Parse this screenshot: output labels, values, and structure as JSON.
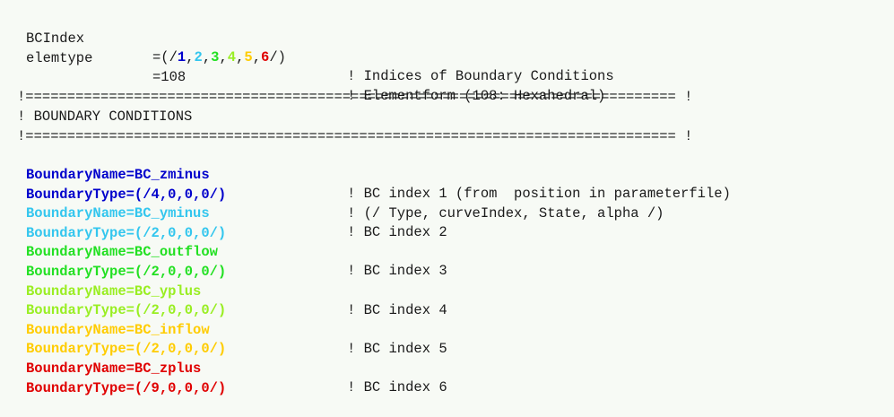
{
  "colors": {
    "text": "#1a1a1a",
    "background": "#f7faf5",
    "bc1": "#0000cc",
    "bc2": "#33c6ee",
    "bc3": "#22e022",
    "bc4": "#99ee22",
    "bc5": "#ffcc00",
    "bc6": "#e00000"
  },
  "header": {
    "bcindex_key": "BCIndex",
    "bcindex_prefix": "=(/",
    "bcindex_values": [
      "1",
      "2",
      "3",
      "4",
      "5",
      "6"
    ],
    "bcindex_suffix": "/)",
    "bcindex_comment": "! Indices of Boundary Conditions",
    "elemtype_key": "elemtype",
    "elemtype_value": "=108",
    "elemtype_comment": "! Elementform (108: Hexahedral)"
  },
  "banner": {
    "rule": "!============================================================================== !",
    "title": "! BOUNDARY CONDITIONS"
  },
  "boundaries": [
    {
      "name_line": "BoundaryName=BC_zminus",
      "type_line": "BoundaryType=(/4,0,0,0/)",
      "comment_name": "! BC index 1 (from  position in parameterfile)",
      "comment_type": "! (/ Type, curveIndex, State, alpha /)"
    },
    {
      "name_line": "BoundaryName=BC_yminus",
      "type_line": "BoundaryType=(/2,0,0,0/)",
      "comment_name": "! BC index 2",
      "comment_type": ""
    },
    {
      "name_line": "BoundaryName=BC_outflow",
      "type_line": "BoundaryType=(/2,0,0,0/)",
      "comment_name": "! BC index 3",
      "comment_type": ""
    },
    {
      "name_line": "BoundaryName=BC_yplus",
      "type_line": "BoundaryType=(/2,0,0,0/)",
      "comment_name": "! BC index 4",
      "comment_type": ""
    },
    {
      "name_line": "BoundaryName=BC_inflow",
      "type_line": "BoundaryType=(/2,0,0,0/)",
      "comment_name": "! BC index 5",
      "comment_type": ""
    },
    {
      "name_line": "BoundaryName=BC_zplus",
      "type_line": "BoundaryType=(/9,0,0,0/)",
      "comment_name": "! BC index 6",
      "comment_type": ""
    }
  ]
}
